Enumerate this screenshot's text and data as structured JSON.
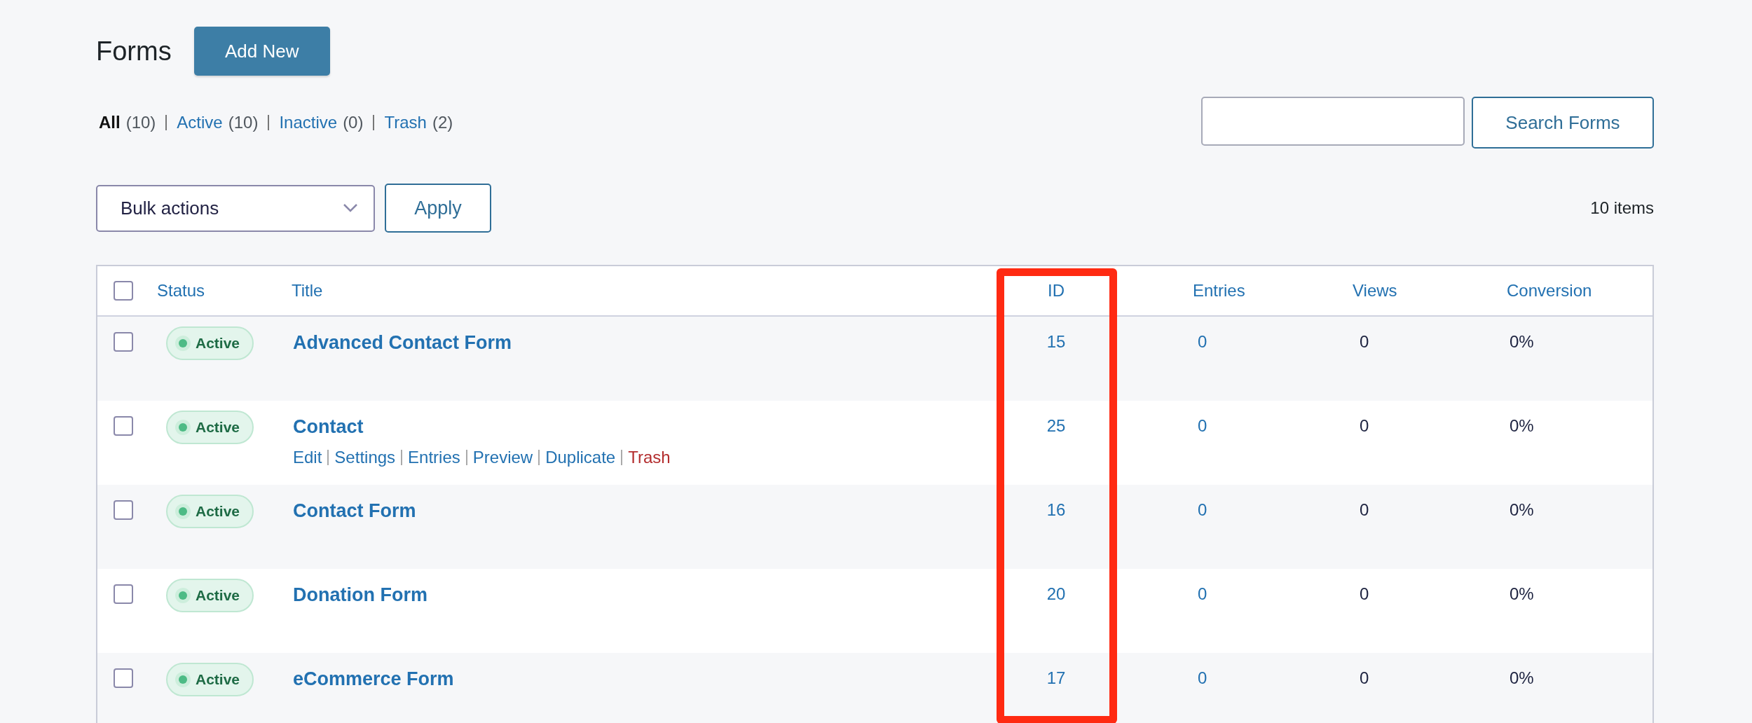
{
  "page": {
    "title": "Forms",
    "add_button": "Add New"
  },
  "filters": [
    {
      "label": "All",
      "count": "(10)",
      "selected": true
    },
    {
      "label": "Active",
      "count": "(10)",
      "selected": false
    },
    {
      "label": "Inactive",
      "count": "(0)",
      "selected": false
    },
    {
      "label": "Trash",
      "count": "(2)",
      "selected": false
    }
  ],
  "search": {
    "button": "Search Forms"
  },
  "bulk": {
    "select": "Bulk actions",
    "apply": "Apply"
  },
  "item_count": "10 items",
  "table": {
    "header_checked": false,
    "columns": [
      "Status",
      "Title",
      "ID",
      "Entries",
      "Views",
      "Conversion"
    ],
    "rows": [
      {
        "checked": false,
        "status": "Active",
        "title": "Advanced Contact Form",
        "id": "15",
        "entries": "0",
        "views": "0",
        "conversion": "0%"
      },
      {
        "checked": false,
        "status": "Active",
        "title": "Contact",
        "id": "25",
        "entries": "0",
        "views": "0",
        "conversion": "0%",
        "actions": [
          {
            "label": "Edit",
            "kind": "normal"
          },
          {
            "label": "Settings",
            "kind": "normal"
          },
          {
            "label": "Entries",
            "kind": "normal"
          },
          {
            "label": "Preview",
            "kind": "normal"
          },
          {
            "label": "Duplicate",
            "kind": "normal"
          },
          {
            "label": "Trash",
            "kind": "danger"
          }
        ]
      },
      {
        "checked": false,
        "status": "Active",
        "title": "Contact Form",
        "id": "16",
        "entries": "0",
        "views": "0",
        "conversion": "0%"
      },
      {
        "checked": false,
        "status": "Active",
        "title": "Donation Form",
        "id": "20",
        "entries": "0",
        "views": "0",
        "conversion": "0%"
      },
      {
        "checked": false,
        "status": "Active",
        "title": "eCommerce Form",
        "id": "17",
        "entries": "0",
        "views": "0",
        "conversion": "0%"
      }
    ]
  }
}
